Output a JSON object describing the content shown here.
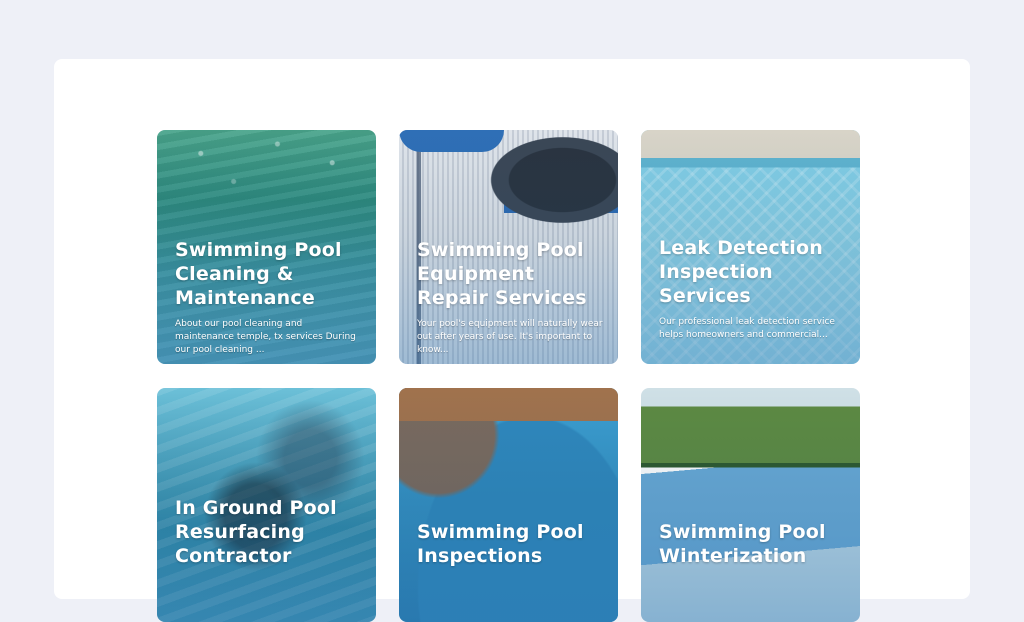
{
  "cards": [
    {
      "title": "Swimming Pool\nCleaning &\nMaintenance",
      "description": "About our pool cleaning and maintenance temple, tx services During our pool cleaning ..."
    },
    {
      "title": "Swimming Pool\nEquipment\nRepair Services",
      "description": "Your pool's equipment will naturally wear out after years of use. It's important to know..."
    },
    {
      "title": "Leak Detection\nInspection\nServices",
      "description": "Our professional leak detection service helps homeowners and commercial..."
    },
    {
      "title": "In Ground Pool\nResurfacing\nContractor",
      "description": ""
    },
    {
      "title": "Swimming Pool\nInspections",
      "description": ""
    },
    {
      "title": "Swimming Pool\nWinterization",
      "description": ""
    }
  ]
}
